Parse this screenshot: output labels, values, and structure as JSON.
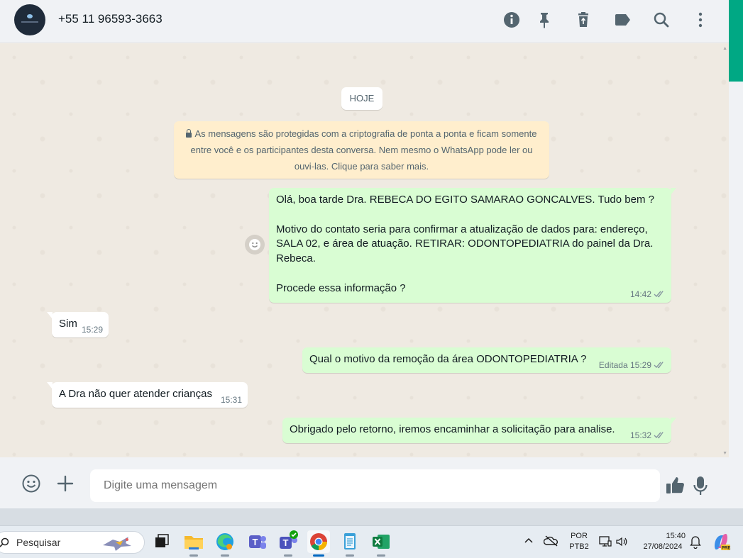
{
  "header": {
    "contact_name": "+55 11 96593-3663",
    "icons": [
      "info-icon",
      "pin-icon",
      "delete-icon",
      "label-icon",
      "search-icon",
      "more-icon"
    ]
  },
  "chat": {
    "date_chip": "HOJE",
    "encryption_note": "As mensagens são protegidas com a criptografia de ponta a ponta e ficam somente entre você e os participantes desta conversa. Nem mesmo o WhatsApp pode ler ou ouvi-las. Clique para saber mais.",
    "messages": [
      {
        "direction": "out",
        "text": "Olá, boa tarde Dra. REBECA DO EGITO SAMARAO GONCALVES. Tudo bem ?\n\nMotivo do contato seria para confirmar a atualização de dados para: endereço, SALA 02, e área de atuação. RETIRAR: ODONTOPEDIATRIA do painel da Dra. Rebeca.\n\nProcede essa informação ?",
        "time": "14:42",
        "edited": ""
      },
      {
        "direction": "in",
        "text": "Sim",
        "time": "15:29"
      },
      {
        "direction": "out",
        "text": "Qual o motivo da remoção da área  ODONTOPEDIATRIA ?",
        "time": "15:29",
        "edited": "Editada"
      },
      {
        "direction": "in",
        "text": "A Dra não quer atender crianças",
        "time": "15:31"
      },
      {
        "direction": "out",
        "text": "Obrigado pelo retorno, iremos encaminhar a solicitação para analise.",
        "time": "15:32",
        "edited": ""
      }
    ]
  },
  "composer": {
    "placeholder": "Digite uma mensagem"
  },
  "taskbar": {
    "search_label": "Pesquisar",
    "apps": [
      "task-view",
      "file-explorer",
      "edge",
      "teams-personal",
      "teams-work",
      "chrome",
      "notepad",
      "excel"
    ],
    "language_top": "POR",
    "language_bottom": "PTB2",
    "time": "15:40",
    "date": "27/08/2024",
    "colors": {
      "accent": "#00a884",
      "out_bubble": "#d9fdd3",
      "chat_bg": "#efeae2"
    }
  }
}
